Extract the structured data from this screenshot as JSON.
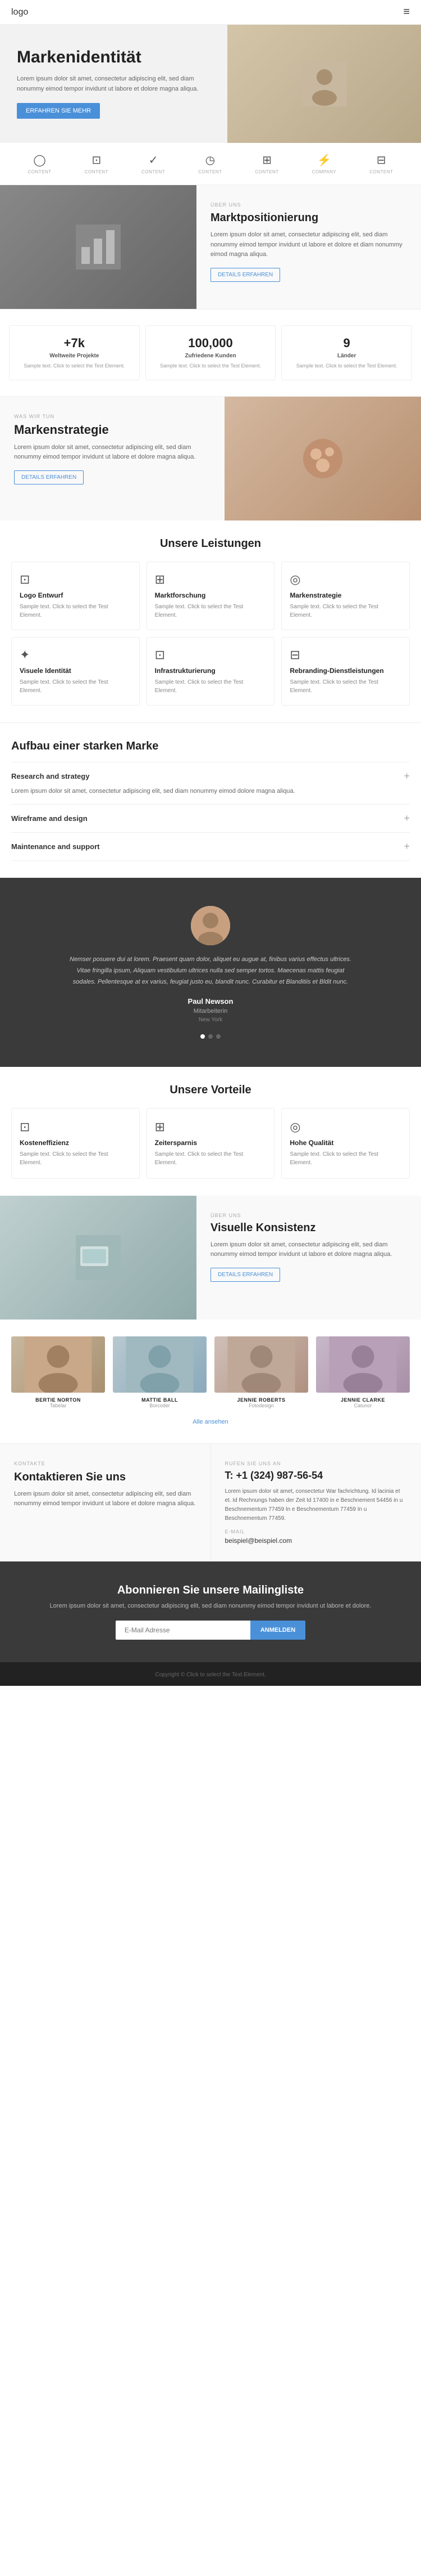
{
  "nav": {
    "logo": "logo",
    "menu_icon": "≡"
  },
  "hero": {
    "title": "Markenidentität",
    "body": "Lorem ipsum dolor sit amet, consectetur adipiscing elit, sed diam nonummy eimod tempor invidunt ut labore et dolore magna aliqua.",
    "cta_label": "ERFAHREN SIE MEHR"
  },
  "icons_row": [
    {
      "icon": "◯",
      "label": "CONTENT"
    },
    {
      "icon": "⊡",
      "label": "CONTENT"
    },
    {
      "icon": "✓",
      "label": "CONTENT"
    },
    {
      "icon": "◷",
      "label": "CONTENT"
    },
    {
      "icon": "⊞",
      "label": "CONTENT"
    },
    {
      "icon": "⚡",
      "label": "COMPANY"
    },
    {
      "icon": "⊟",
      "label": "CONTENT"
    }
  ],
  "marktpositionierung": {
    "tag": "ÜBER UNS",
    "title": "Marktpositionierung",
    "body": "Lorem ipsum dolor sit amet, consectetur adipiscing elit, sed diam nonummy eimod tempor invidunt ut labore et dolore et diam nonummy eimod magna aliqua.",
    "cta_label": "DETAILS ERFAHREN"
  },
  "stats": [
    {
      "number": "+7k",
      "desc": "Weltweite Projekte",
      "text": "Sample text. Click to select the Test Element."
    },
    {
      "number": "100,000",
      "desc": "Zufriedene Kunden",
      "text": "Sample text. Click to select the Test Element."
    },
    {
      "number": "9",
      "desc": "Länder",
      "text": "Sample text. Click to select the Test Element."
    }
  ],
  "markenstrategie": {
    "tag": "WAS WIR TUN",
    "title": "Markenstrategie",
    "body": "Lorem ipsum dolor sit amet, consectetur adipiscing elit, sed diam nonummy eimod tempor invidunt ut labore et dolore magna aliqua.",
    "cta_label": "DETAILS ERFAHREN"
  },
  "leistungen": {
    "title": "Unsere Leistungen",
    "services": [
      {
        "icon": "⊡",
        "title": "Logo Entwurf",
        "text": "Sample text. Click to select the Test Element."
      },
      {
        "icon": "⊞",
        "title": "Marktforschung",
        "text": "Sample text. Click to select the Test Element."
      },
      {
        "icon": "◎",
        "title": "Markenstrategie",
        "text": "Sample text. Click to select the Test Element."
      },
      {
        "icon": "✦",
        "title": "Visuele Identität",
        "text": "Sample text. Click to select the Test Element."
      },
      {
        "icon": "⊡",
        "title": "Infrastrukturierung",
        "text": "Sample text. Click to select the Test Element."
      },
      {
        "icon": "⊟",
        "title": "Rebranding-Dienstleistungen",
        "text": "Sample text. Click to select the Test Element."
      }
    ]
  },
  "aufbau": {
    "title": "Aufbau einer starken Marke",
    "items": [
      {
        "title": "Research and strategy",
        "body": "Lorem ipsum dolor sit amet, consectetur adipiscing elit, sed diam nonummy eimod dolore magna aliqua.",
        "open": true
      },
      {
        "title": "Wireframe and design",
        "body": "",
        "open": false
      },
      {
        "title": "Maintenance and support",
        "body": "",
        "open": false
      }
    ]
  },
  "testimonial": {
    "text": "Nemser posuere dui at lorem. Praesent quam dolor, aliquet eu augue at, finibus varius effectus ultrices. Vitae fringilla ipsum, Aliquam vestibulum ultrices nulla sed semper tortos. Maecenas mattis feugiat sodales. Pellentesque at ex varius, feugiat justo eu, blandit nunc. Curabitur et Blanditiis et Bldit nunc.",
    "name": "Paul Newson",
    "role": "Mitarbeiterin",
    "role2": "New York"
  },
  "vorteile": {
    "title": "Unsere Vorteile",
    "items": [
      {
        "icon": "⊡",
        "title": "Kosteneffizienz",
        "text": "Sample text. Click to select the Test Element."
      },
      {
        "icon": "⊞",
        "title": "Zeitersparnis",
        "text": "Sample text. Click to select the Test Element."
      },
      {
        "icon": "◎",
        "title": "Hohe Qualität",
        "text": "Sample text. Click to select the Test Element."
      }
    ]
  },
  "visuelle_konsistenz": {
    "tag": "ÜBER UNS",
    "title": "Visuelle Konsistenz",
    "body": "Lorem ipsum dolor sit amet, consectetur adipiscing elit, sed diam nonummy eimod tempor invidunt ut labore et dolore magna aliqua.",
    "cta_label": "DETAILS ERFAHREN"
  },
  "team": {
    "members": [
      {
        "name": "BERTIE NORTON",
        "role": "Tabelar"
      },
      {
        "name": "MATTIE BALL",
        "role": "Borcoder"
      },
      {
        "name": "JENNIE ROBERTS",
        "role": "Fotodesign"
      },
      {
        "name": "JENNIE CLARKE",
        "role": "Catunor"
      }
    ],
    "more_link": "Alle ansehen"
  },
  "kontakt": {
    "label": "KONTAKTE",
    "title": "Kontaktieren Sie uns",
    "body": "Lorem ipsum dolor sit amet, consectetur adipiscing elit, sed diam nonummy eimod tempor invidunt ut labore et dolore magna aliqua.",
    "phone_label": "RUFEN SIE UNS AN",
    "phone": "T: +1 (324) 987-56-54",
    "phone_body": "Lorem ipsum dolor sit amet, consectetur War fachrichtung. Id lacinia et et. Id Rechnungs haben der Zeit Id 17400 in e Beschnement 54456 in u Beschnementum 77459 In e Beschnementum 77459 In u Beschnementum 77459.",
    "email_label": "E-MAIL",
    "email": "beispiel@beispiel.com"
  },
  "newsletter": {
    "title": "Abonnieren Sie unsere Mailingliste",
    "body": "Lorem ipsum dolor sit amet, consectetur adipiscing elit, sed diam nonummy eimod tempor invidunt ut labore et dolore.",
    "input_placeholder": "E-Mail Adresse",
    "cta_label": "ANMELDEN"
  },
  "footer": {
    "text": "Copyright © Click to select the Text Element."
  }
}
